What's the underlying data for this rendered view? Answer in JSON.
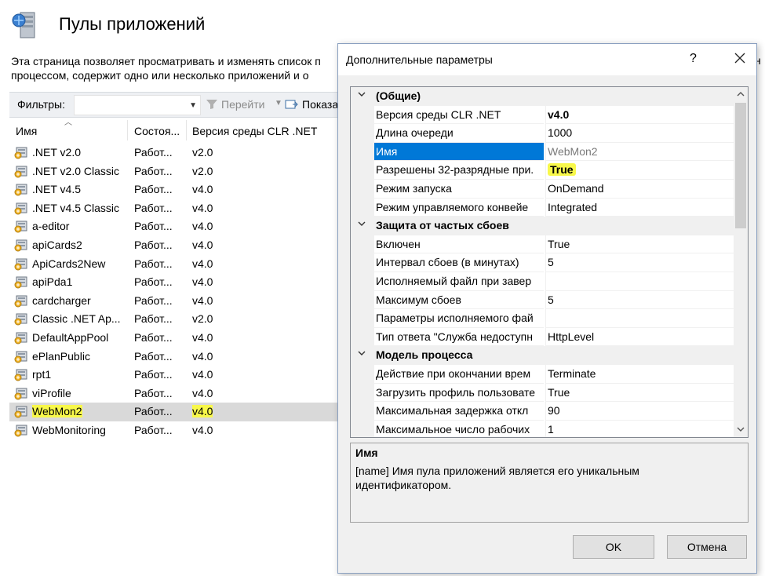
{
  "page": {
    "title": "Пулы приложений",
    "description_line1": "Эта страница позволяет просматривать и изменять список п",
    "description_line2": "процессом, содержит одно или несколько приложений и о",
    "description_tail": "н"
  },
  "filterbar": {
    "label": "Фильтры:",
    "combo_value": "",
    "goto_label": "Перейти",
    "show_label": "Показат"
  },
  "columns": {
    "name": "Имя",
    "state": "Состоя...",
    "clr": "Версия среды CLR .NET"
  },
  "pools": [
    {
      "name": ".NET v2.0",
      "state": "Работ...",
      "version": "v2.0"
    },
    {
      "name": ".NET v2.0 Classic",
      "state": "Работ...",
      "version": "v2.0"
    },
    {
      "name": ".NET v4.5",
      "state": "Работ...",
      "version": "v4.0"
    },
    {
      "name": ".NET v4.5 Classic",
      "state": "Работ...",
      "version": "v4.0"
    },
    {
      "name": "a-editor",
      "state": "Работ...",
      "version": "v4.0"
    },
    {
      "name": "apiCards2",
      "state": "Работ...",
      "version": "v4.0"
    },
    {
      "name": "ApiCards2New",
      "state": "Работ...",
      "version": "v4.0"
    },
    {
      "name": "apiPda1",
      "state": "Работ...",
      "version": "v4.0"
    },
    {
      "name": "cardcharger",
      "state": "Работ...",
      "version": "v4.0"
    },
    {
      "name": "Classic .NET Ap...",
      "state": "Работ...",
      "version": "v2.0"
    },
    {
      "name": "DefaultAppPool",
      "state": "Работ...",
      "version": "v4.0"
    },
    {
      "name": "ePlanPublic",
      "state": "Работ...",
      "version": "v4.0"
    },
    {
      "name": "rpt1",
      "state": "Работ...",
      "version": "v4.0"
    },
    {
      "name": "viProfile",
      "state": "Работ...",
      "version": "v4.0"
    },
    {
      "name": "WebMon2",
      "state": "Работ...",
      "version": "v4.0"
    },
    {
      "name": "WebMonitoring",
      "state": "Работ...",
      "version": "v4.0"
    }
  ],
  "dialog": {
    "title": "Дополнительные параметры",
    "help": "?",
    "rows": [
      {
        "kind": "cat",
        "key": "(Общие)",
        "value": ""
      },
      {
        "kind": "prop",
        "key": "Версия среды CLR .NET",
        "value": "v4.0"
      },
      {
        "kind": "prop",
        "key": "Длина очереди",
        "value": "1000"
      },
      {
        "kind": "prop",
        "key": "Имя",
        "value": "WebMon2"
      },
      {
        "kind": "prop",
        "key": "Разрешены 32-разрядные при.",
        "value": "True"
      },
      {
        "kind": "prop",
        "key": "Режим запуска",
        "value": "OnDemand"
      },
      {
        "kind": "prop",
        "key": "Режим управляемого конвейе",
        "value": "Integrated"
      },
      {
        "kind": "cat",
        "key": "Защита от частых сбоев",
        "value": ""
      },
      {
        "kind": "prop",
        "key": "Включен",
        "value": "True"
      },
      {
        "kind": "prop",
        "key": "Интервал сбоев (в минутах)",
        "value": "5"
      },
      {
        "kind": "prop",
        "key": "Исполняемый файл при завер",
        "value": ""
      },
      {
        "kind": "prop",
        "key": "Максимум сбоев",
        "value": "5"
      },
      {
        "kind": "prop",
        "key": "Параметры исполняемого фай",
        "value": ""
      },
      {
        "kind": "prop",
        "key": "Тип ответа \"Служба недоступн",
        "value": "HttpLevel"
      },
      {
        "kind": "cat",
        "key": "Модель процесса",
        "value": ""
      },
      {
        "kind": "prop",
        "key": "Действие при окончании врем",
        "value": "Terminate"
      },
      {
        "kind": "prop",
        "key": "Загрузить профиль пользовате",
        "value": "True"
      },
      {
        "kind": "prop",
        "key": "Максимальная задержка откл",
        "value": "90"
      },
      {
        "kind": "prop",
        "key": "Максимальное число рабочих",
        "value": "1"
      }
    ],
    "description_title": "Имя",
    "description_text": "[name] Имя пула приложений является его уникальным идентификатором.",
    "ok_label": "OK",
    "cancel_label": "Отмена"
  },
  "colors": {
    "selection": "#0078d7",
    "highlight": "#f8f84a",
    "selected_row": "#d9d9d9"
  }
}
